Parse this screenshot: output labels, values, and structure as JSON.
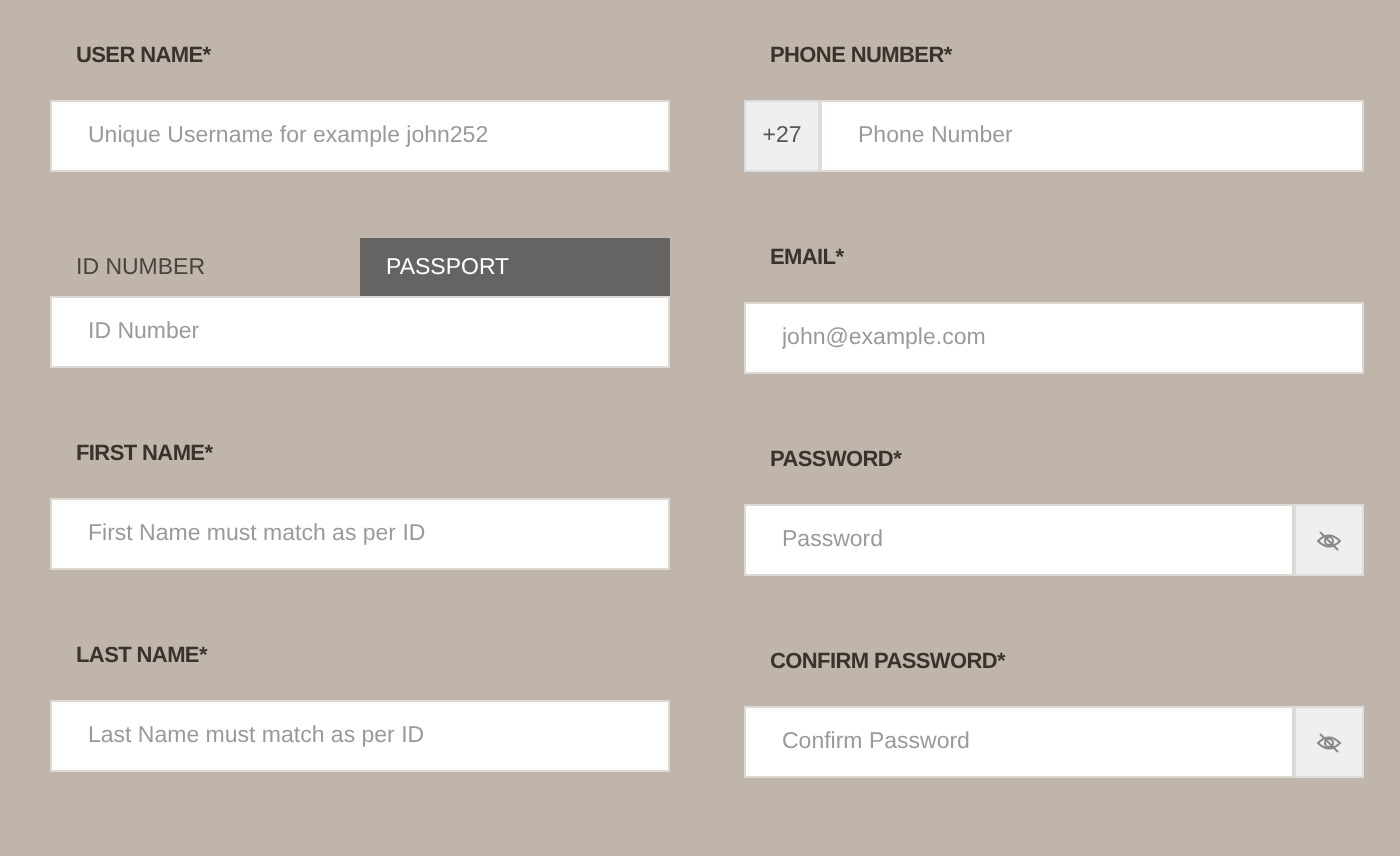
{
  "left_column": [
    {
      "kind": "text",
      "label": "USER NAME*",
      "placeholder": "Unique Username for example john252"
    },
    {
      "kind": "tabbed",
      "tabs": [
        {
          "label": "ID NUMBER",
          "selected": false
        },
        {
          "label": "PASSPORT",
          "selected": true
        }
      ],
      "placeholder": "ID Number"
    },
    {
      "kind": "text",
      "label": "FIRST NAME*",
      "placeholder": "First Name must match as per ID"
    },
    {
      "kind": "text",
      "label": "LAST NAME*",
      "placeholder": "Last Name must match as per ID"
    }
  ],
  "right_column": [
    {
      "kind": "phone",
      "label": "PHONE NUMBER*",
      "prefix": "+27",
      "placeholder": "Phone Number"
    },
    {
      "kind": "text",
      "label": "EMAIL*",
      "placeholder": "john@example.com"
    },
    {
      "kind": "password",
      "label": "PASSWORD*",
      "placeholder": "Password"
    },
    {
      "kind": "password",
      "label": "CONFIRM PASSWORD*",
      "placeholder": "Confirm Password"
    }
  ]
}
